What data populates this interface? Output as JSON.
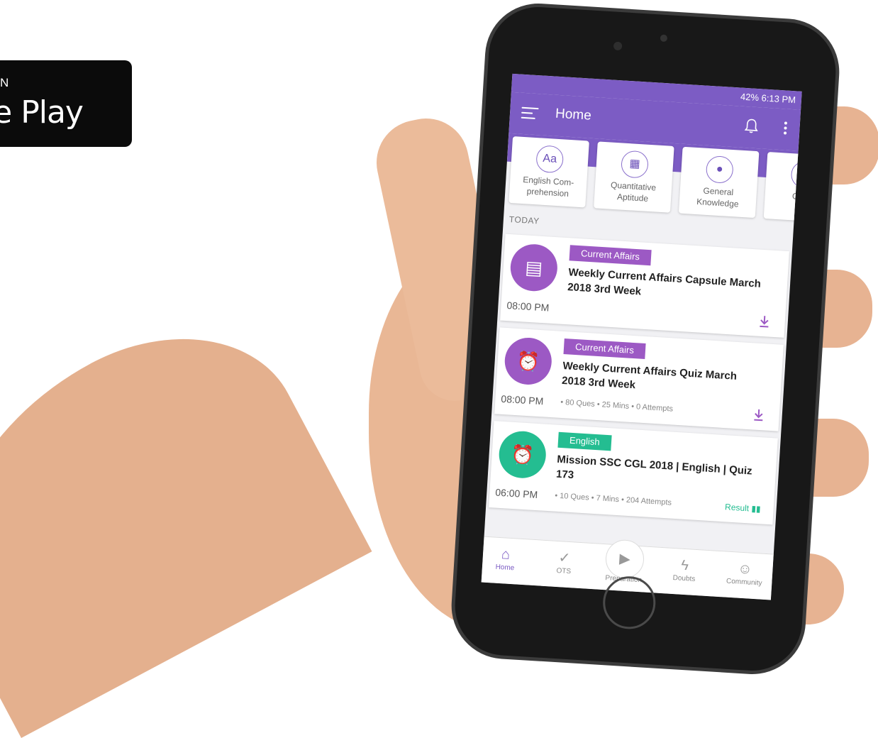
{
  "badge": {
    "top_line": "N",
    "store_name": "gle Play"
  },
  "status_bar": {
    "text": "42% 6:13 PM"
  },
  "app_bar": {
    "title": "Home"
  },
  "categories": [
    {
      "icon": "Aa",
      "label": "English Com-prehension"
    },
    {
      "icon": "calculator-icon",
      "label": "Quantitative Aptitude"
    },
    {
      "icon": "globe-icon",
      "label": "General Knowledge"
    },
    {
      "icon": "",
      "label": "Ge lig"
    }
  ],
  "section_label": "TODAY",
  "cards": [
    {
      "tag": "Current Affairs",
      "title": "Weekly Current Affairs Capsule March 2018 3rd Week",
      "time": "08:00 PM",
      "meta": "",
      "action": "download-icon",
      "color": "#9c59c4"
    },
    {
      "tag": "Current Affairs",
      "title": "Weekly Current Affairs Quiz March 2018 3rd Week",
      "time": "08:00 PM",
      "meta": "• 80 Ques • 25 Mins • 0 Attempts",
      "action": "download-icon",
      "color": "#9c59c4"
    },
    {
      "tag": "English",
      "title": "Mission SSC CGL 2018 | English | Quiz 173",
      "time": "06:00 PM",
      "meta": "• 10 Ques • 7 Mins • 204 Attempts",
      "action": "Result",
      "color": "#24bd91"
    }
  ],
  "bottom_nav": [
    {
      "label": "Home",
      "icon": "home-icon",
      "active": true
    },
    {
      "label": "OTS",
      "icon": "check-icon",
      "active": false
    },
    {
      "label": "Preparation",
      "icon": "play-icon",
      "active": false
    },
    {
      "label": "Doubts",
      "icon": "bolt-icon",
      "active": false
    },
    {
      "label": "Community",
      "icon": "people-icon",
      "active": false
    }
  ],
  "colors": {
    "primary": "#7c5cc4",
    "purple_tag": "#9c59c4",
    "green_tag": "#24bd91"
  }
}
